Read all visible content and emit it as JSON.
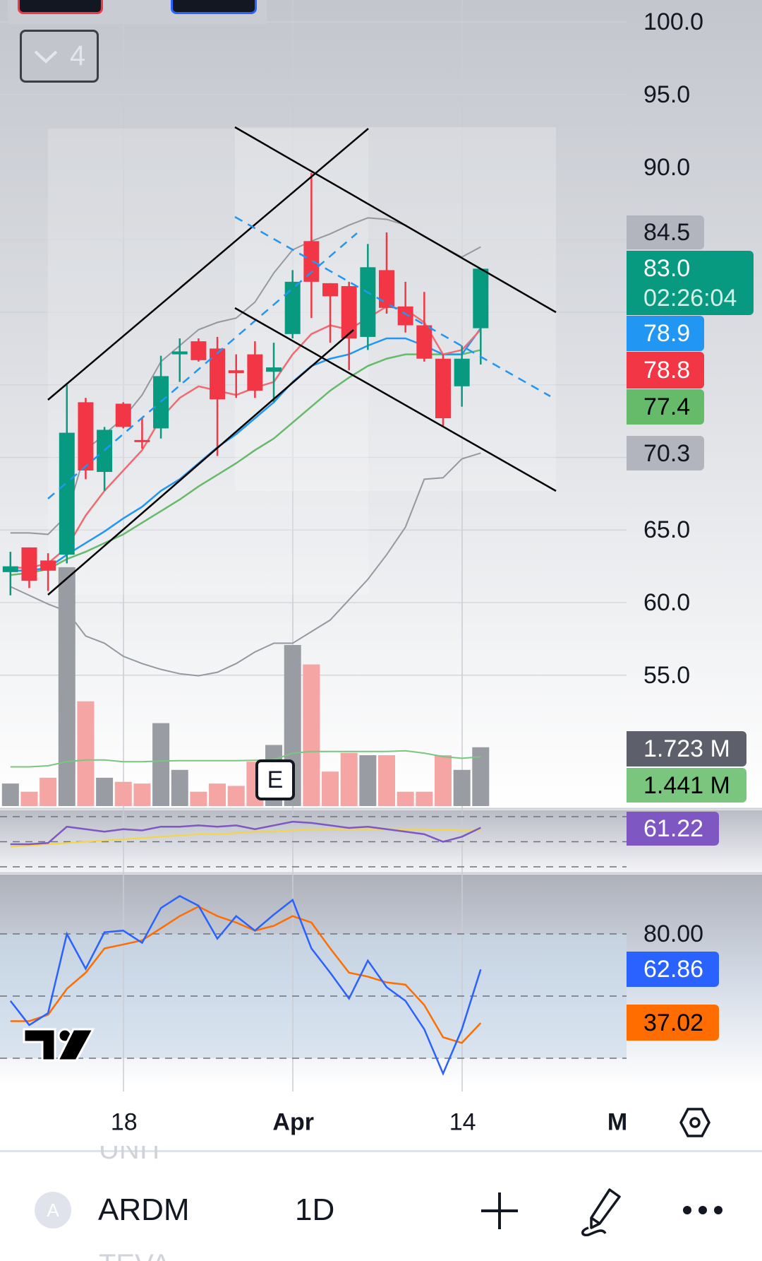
{
  "toolbar": {
    "collapse_count": "4"
  },
  "symbol_bar": {
    "avatar_letter": "A",
    "symbol": "ARDM",
    "interval": "1D",
    "prev_symbol": "UNIT",
    "next_symbol": "TEVA"
  },
  "earnings_marker": "E",
  "badges": {
    "bb_upper": "84.5",
    "last_price": "83.0",
    "countdown": "02:26:04",
    "ma_blue": "78.9",
    "ma_red": "78.8",
    "ma_green": "77.4",
    "bb_lower": "70.3",
    "volume": "1.723 M",
    "volume_ma": "1.441 M",
    "rsi": "61.22",
    "stoch_k": "62.86",
    "stoch_d": "37.02"
  },
  "colors": {
    "up": "#089981",
    "down": "#f23645",
    "ma_red": "#f06a72",
    "ma_blue": "#2196f3",
    "ma_green": "#66bb6a",
    "bb": "#9598a1",
    "rsi": "#7e57c2",
    "rsi_ma": "#f5d63d",
    "stoch_k": "#2962ff",
    "stoch_d": "#ff6d00"
  },
  "chart_data": {
    "type": "candlestick",
    "price_ticks": [
      {
        "label": "100.0",
        "value": 100
      },
      {
        "label": "95.0",
        "value": 95
      },
      {
        "label": "90.0",
        "value": 90
      },
      {
        "label": "65.0",
        "value": 65
      },
      {
        "label": "60.0",
        "value": 60
      },
      {
        "label": "55.0",
        "value": 55
      }
    ],
    "time_ticks": [
      {
        "label": "18",
        "index": 6,
        "bold": false
      },
      {
        "label": "Apr",
        "index": 15,
        "bold": true
      },
      {
        "label": "14",
        "index": 24,
        "bold": false
      }
    ],
    "timeframe_button": "M",
    "candles": [
      [
        62.1,
        63.5,
        60.5,
        62.5
      ],
      [
        63.8,
        63.8,
        61.0,
        61.5
      ],
      [
        62.9,
        63.4,
        60.8,
        62.2
      ],
      [
        63.3,
        75.0,
        62.7,
        71.7
      ],
      [
        73.8,
        74.1,
        68.5,
        69.1
      ],
      [
        69.0,
        72.1,
        67.7,
        71.9
      ],
      [
        73.7,
        73.8,
        72.0,
        72.1
      ],
      [
        71.2,
        72.7,
        70.6,
        71.1
      ],
      [
        72.0,
        77.0,
        71.3,
        75.6
      ],
      [
        77.1,
        78.2,
        75.2,
        77.3
      ],
      [
        78.0,
        78.2,
        76.6,
        76.7
      ],
      [
        77.5,
        78.3,
        70.1,
        74.0
      ],
      [
        76.0,
        77.1,
        74.1,
        75.8
      ],
      [
        77.1,
        78.0,
        74.1,
        74.6
      ],
      [
        75.9,
        77.9,
        73.8,
        76.2
      ],
      [
        78.5,
        82.9,
        78.2,
        82.1
      ],
      [
        84.9,
        89.6,
        79.6,
        82.1
      ],
      [
        82.0,
        82.0,
        77.9,
        81.1
      ],
      [
        81.8,
        82.1,
        76.0,
        78.2
      ],
      [
        78.3,
        84.7,
        77.4,
        83.1
      ],
      [
        82.9,
        85.5,
        79.9,
        80.3
      ],
      [
        80.4,
        82.1,
        78.6,
        79.1
      ],
      [
        79.1,
        81.4,
        76.6,
        76.8
      ],
      [
        76.8,
        77.1,
        72.1,
        72.7
      ],
      [
        74.9,
        77.7,
        73.5,
        76.8
      ],
      [
        78.9,
        83.0,
        76.4,
        83.0
      ]
    ],
    "ma_red": [
      62.4,
      62.4,
      62.7,
      63.8,
      66.0,
      67.7,
      69.1,
      70.5,
      72.7,
      74.1,
      74.9,
      74.6,
      74.3,
      74.8,
      75.2,
      77.1,
      78.5,
      79.1,
      78.8,
      79.6,
      80.4,
      80.2,
      79.3,
      77.1,
      77.4,
      78.8
    ],
    "ma_blue": [
      62.2,
      62.2,
      62.4,
      63.3,
      64.1,
      64.9,
      65.8,
      66.6,
      67.7,
      68.5,
      69.6,
      70.7,
      71.6,
      72.7,
      73.8,
      75.2,
      76.3,
      76.8,
      77.1,
      77.7,
      78.2,
      78.2,
      77.7,
      77.1,
      77.1,
      78.9
    ],
    "ma_green": [
      61.9,
      62.05,
      62.3,
      63.0,
      63.5,
      64.1,
      64.7,
      65.5,
      66.3,
      67.1,
      68.0,
      68.8,
      69.6,
      70.5,
      71.3,
      72.4,
      73.5,
      74.6,
      75.5,
      76.3,
      76.8,
      77.1,
      77.1,
      77.1,
      77.1,
      77.4
    ],
    "bb_upper": [
      64.8,
      64.8,
      64.7,
      66.0,
      70.5,
      71.6,
      72.7,
      74.3,
      76.6,
      77.7,
      78.8,
      79.3,
      79.6,
      80.7,
      82.7,
      84.3,
      84.9,
      85.4,
      86.0,
      86.5,
      86.4,
      86.0,
      85.2,
      84.5,
      83.8,
      84.5
    ],
    "bb_lower": [
      61.1,
      60.5,
      59.9,
      59.4,
      57.7,
      57.2,
      56.3,
      55.8,
      55.4,
      55.1,
      54.96,
      55.2,
      55.8,
      56.6,
      57.2,
      57.2,
      58.0,
      58.8,
      60.2,
      61.6,
      63.3,
      65.2,
      68.5,
      68.6,
      69.9,
      70.3
    ],
    "volume_millions": [
      0.66,
      0.42,
      0.83,
      7.0,
      3.07,
      0.83,
      0.71,
      0.66,
      2.43,
      1.06,
      0.42,
      0.66,
      0.59,
      1.3,
      1.79,
      4.72,
      4.15,
      1.01,
      1.56,
      1.49,
      1.49,
      0.42,
      0.42,
      1.49,
      1.06,
      1.723
    ],
    "volume_ma": [
      1.15,
      1.15,
      1.18,
      1.3,
      1.35,
      1.35,
      1.3,
      1.3,
      1.32,
      1.33,
      1.33,
      1.33,
      1.33,
      1.34,
      1.36,
      1.55,
      1.6,
      1.6,
      1.6,
      1.6,
      1.6,
      1.62,
      1.55,
      1.45,
      1.4,
      1.441
    ],
    "rsi": [
      48,
      48,
      49,
      62,
      60,
      58,
      60,
      59,
      62,
      62,
      63,
      62,
      63,
      60,
      63,
      66,
      65,
      63,
      61,
      62,
      60,
      58,
      56,
      50,
      54,
      61.22
    ],
    "rsi_ma": [
      46,
      47,
      48,
      49,
      50,
      51,
      52,
      53,
      54,
      55,
      56,
      56,
      57,
      58,
      58,
      59,
      60,
      60,
      60,
      60,
      60,
      60,
      60,
      59.5,
      59,
      59
    ],
    "rsi_levels": [
      70,
      50,
      30
    ],
    "stoch_k": [
      47.7,
      36.0,
      41.8,
      80,
      63.2,
      80.8,
      81.6,
      75.7,
      92.5,
      98.3,
      93.6,
      77.7,
      88.6,
      81.6,
      89.3,
      96.4,
      73.0,
      61.3,
      48.8,
      67.1,
      54.3,
      47.7,
      34.0,
      12.6,
      34.0,
      62.86
    ],
    "stoch_d": [
      37.9,
      37.9,
      41.0,
      53.5,
      61.3,
      73.0,
      74.9,
      76.9,
      82.7,
      88.6,
      93.2,
      88.6,
      85.5,
      81.6,
      83.9,
      88.6,
      85.5,
      73.0,
      61.3,
      59.4,
      56.6,
      55.5,
      45.7,
      30.1,
      27.4,
      37.02
    ],
    "stoch_ticks": [
      {
        "label": "80.00",
        "value": 80
      }
    ],
    "stoch_levels": [
      80,
      50,
      20
    ]
  }
}
